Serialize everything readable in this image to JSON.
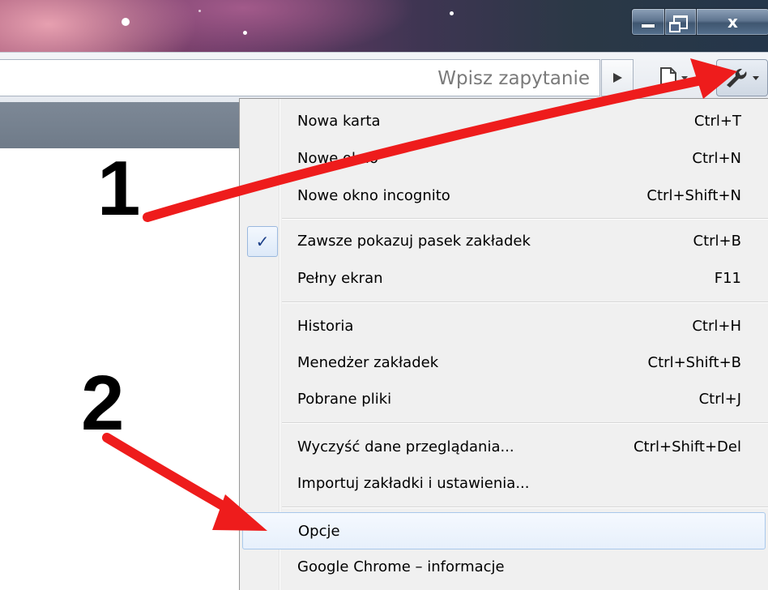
{
  "window": {
    "minimize_icon": "minimize-icon",
    "maximize_icon": "restore-icon",
    "close_label": "x"
  },
  "toolbar": {
    "omnibox_placeholder": "Wpisz zapytanie",
    "go_icon": "play-icon",
    "page_icon": "page-icon",
    "wrench_icon": "wrench-icon"
  },
  "menu": {
    "groups": [
      [
        {
          "label": "Nowa karta",
          "shortcut": "Ctrl+T"
        },
        {
          "label": "Nowe okno",
          "shortcut": "Ctrl+N"
        },
        {
          "label": "Nowe okno incognito",
          "shortcut": "Ctrl+Shift+N"
        }
      ],
      [
        {
          "label": "Zawsze pokazuj pasek zakładek",
          "shortcut": "Ctrl+B",
          "checked": true
        },
        {
          "label": "Pełny ekran",
          "shortcut": "F11"
        }
      ],
      [
        {
          "label": "Historia",
          "shortcut": "Ctrl+H"
        },
        {
          "label": "Menedżer zakładek",
          "shortcut": "Ctrl+Shift+B"
        },
        {
          "label": "Pobrane pliki",
          "shortcut": "Ctrl+J"
        }
      ],
      [
        {
          "label": "Wyczyść dane przeglądania...",
          "shortcut": "Ctrl+Shift+Del"
        },
        {
          "label": "Importuj zakładki i ustawienia...",
          "shortcut": ""
        }
      ],
      [
        {
          "label": "Opcje",
          "shortcut": "",
          "highlighted": true
        },
        {
          "label": "Google Chrome – informacje",
          "shortcut": ""
        }
      ]
    ],
    "check_mark": "✓"
  },
  "annotations": {
    "step1": "1",
    "step2": "2",
    "arrow_color": "#ee1c1c"
  }
}
